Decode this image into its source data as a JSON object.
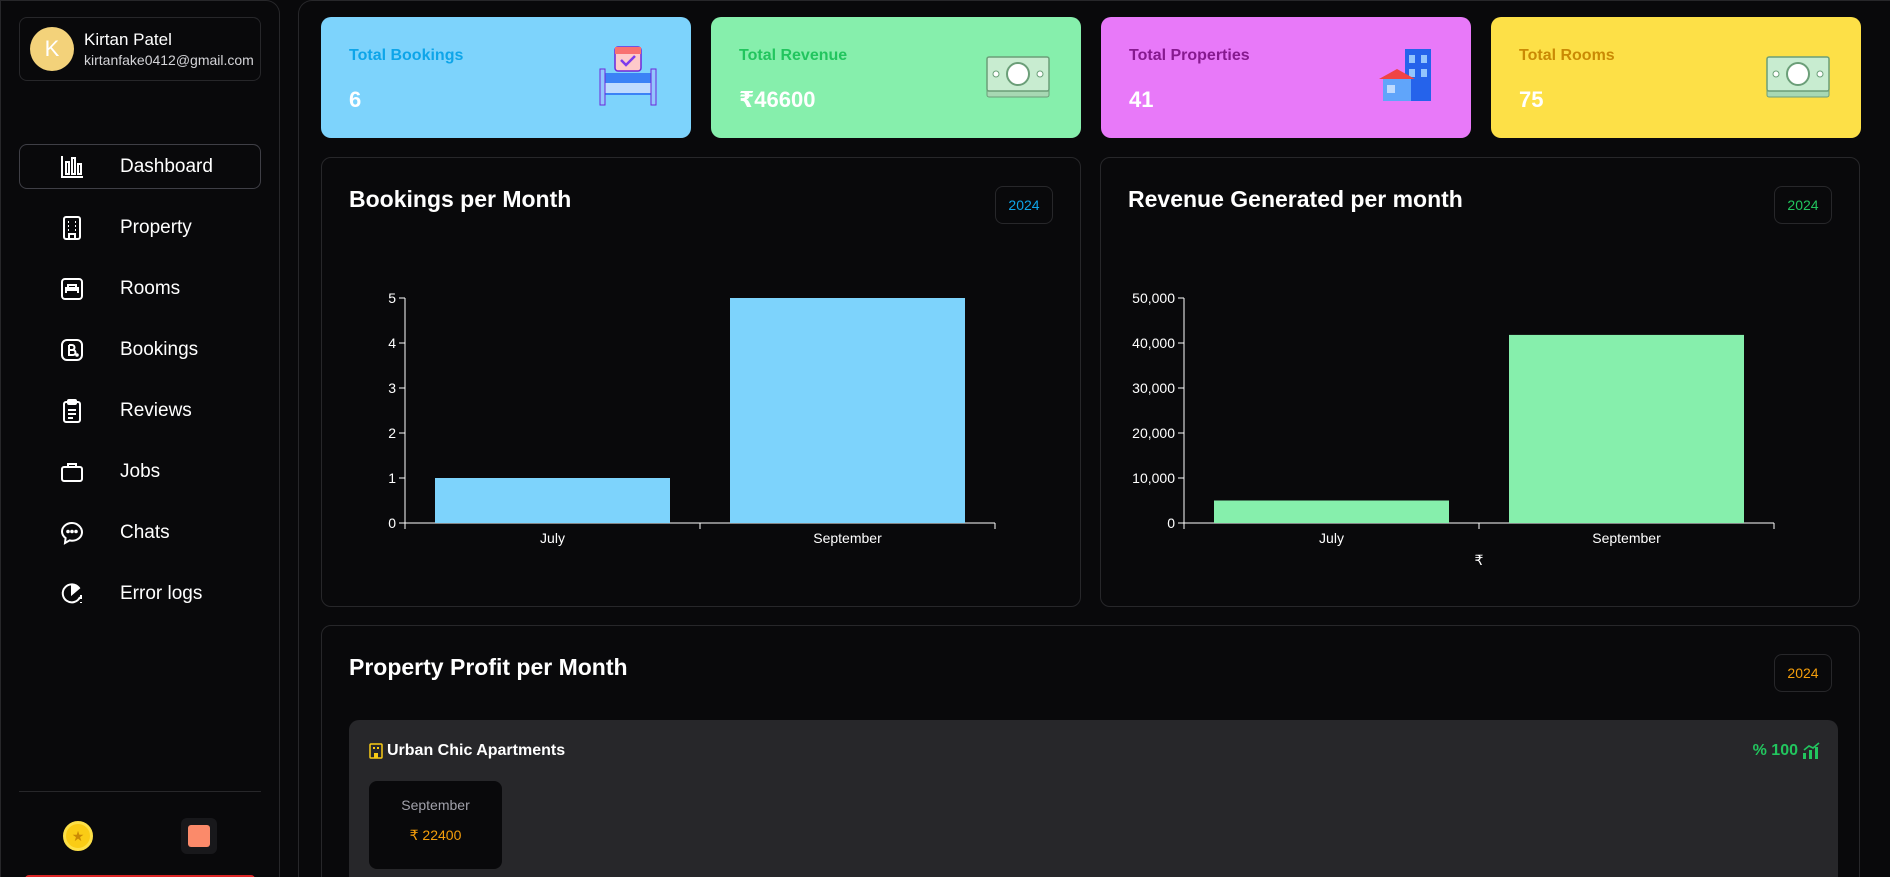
{
  "user": {
    "initial": "K",
    "name": "Kirtan Patel",
    "email": "kirtanfake0412@gmail.com"
  },
  "nav": [
    {
      "label": "Dashboard",
      "icon": "bar-chart-icon",
      "active": true
    },
    {
      "label": "Property",
      "icon": "building-icon"
    },
    {
      "label": "Rooms",
      "icon": "bed-icon"
    },
    {
      "label": "Bookings",
      "icon": "booking-icon"
    },
    {
      "label": "Reviews",
      "icon": "clipboard-icon"
    },
    {
      "label": "Jobs",
      "icon": "briefcase-icon"
    },
    {
      "label": "Chats",
      "icon": "chat-icon"
    },
    {
      "label": "Error logs",
      "icon": "error-log-icon"
    }
  ],
  "stats": [
    {
      "label": "Total Bookings",
      "value": "6",
      "bg": "#7dd3fc",
      "fg": "#0ea5e9",
      "icon": "bed-calendar-icon"
    },
    {
      "label": "Total Revenue",
      "value": "₹46600",
      "bg": "#86efac",
      "fg": "#22c55e",
      "icon": "money-icon"
    },
    {
      "label": "Total Properties",
      "value": "41",
      "bg": "#e879f9",
      "fg": "#86198f",
      "icon": "buildings-icon"
    },
    {
      "label": "Total Rooms",
      "value": "75",
      "bg": "#fde047",
      "fg": "#ca8a04",
      "icon": "money-icon"
    }
  ],
  "bookings_card": {
    "title": "Bookings per Month",
    "year": "2024",
    "year_color": "#0ea5e9"
  },
  "revenue_card": {
    "title": "Revenue Generated per month",
    "year": "2024",
    "year_color": "#22c55e"
  },
  "profit_card": {
    "title": "Property Profit per Month",
    "year": "2024",
    "year_color": "#f59e0b",
    "property": {
      "name": "Urban Chic Apartments",
      "percent": "% 100",
      "month": "September",
      "value": "₹ 22400"
    }
  },
  "chart_data": [
    {
      "type": "bar",
      "title": "",
      "categories": [
        "July",
        "September"
      ],
      "values": [
        1,
        5
      ],
      "ylim": [
        0,
        5
      ],
      "yticks": [
        0,
        1,
        2,
        3,
        4,
        5
      ],
      "ytick_labels": [
        "0",
        "1",
        "2",
        "3",
        "4",
        "5"
      ],
      "xlabel": "",
      "ylabel": "",
      "color": "#7dd3fc",
      "grid": false
    },
    {
      "type": "bar",
      "title": "",
      "categories": [
        "July",
        "September"
      ],
      "values": [
        5000,
        41800
      ],
      "ylim": [
        0,
        50000
      ],
      "yticks": [
        0,
        10000,
        20000,
        30000,
        40000,
        50000
      ],
      "ytick_labels": [
        "0",
        "10,000",
        "20,000",
        "30,000",
        "40,000",
        "50,000"
      ],
      "xlabel": "₹",
      "ylabel": "",
      "color": "#86efac",
      "grid": false
    }
  ]
}
